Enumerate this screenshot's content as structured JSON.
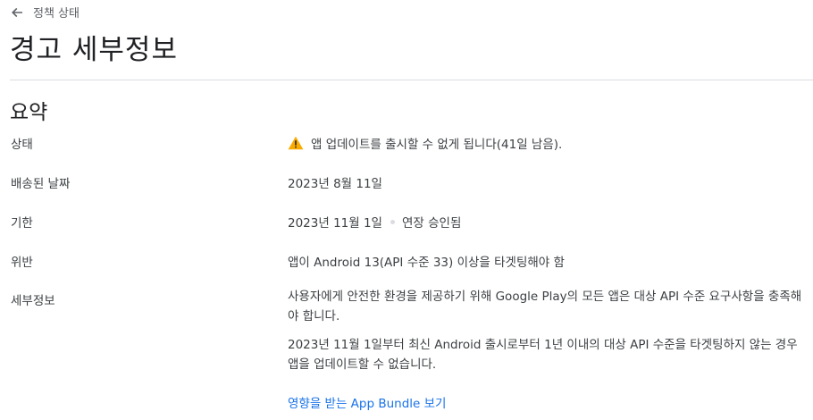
{
  "header": {
    "back_label": "정책 상태",
    "title": "경고 세부정보"
  },
  "summary": {
    "title": "요약",
    "rows": [
      {
        "label": "상태",
        "value": "앱 업데이트를 출시할 수 없게 됩니다(41일 남음).",
        "icon": "warning-icon"
      },
      {
        "label": "배송된 날짜",
        "value": "2023년 8월 11일"
      },
      {
        "label": "기한",
        "value": "2023년 11월 1일",
        "extra": "연장 승인됨"
      },
      {
        "label": "위반",
        "value": "앱이 Android 13(API 수준 33) 이상을 타겟팅해야 함"
      },
      {
        "label": "세부정보",
        "paragraphs": [
          "사용자에게 안전한 환경을 제공하기 위해 Google Play의 모든 앱은 대상 API 수준 요구사항을 충족해야 합니다.",
          "2023년 11월 1일부터 최신 Android 출시로부터 1년 이내의 대상 API 수준을 타겟팅하지 않는 경우 앱을 업데이트할 수 없습니다."
        ],
        "link": "영향을 받는 App Bundle 보기"
      }
    ]
  },
  "colors": {
    "warning": "#f9ab00",
    "link": "#1a73e8"
  }
}
